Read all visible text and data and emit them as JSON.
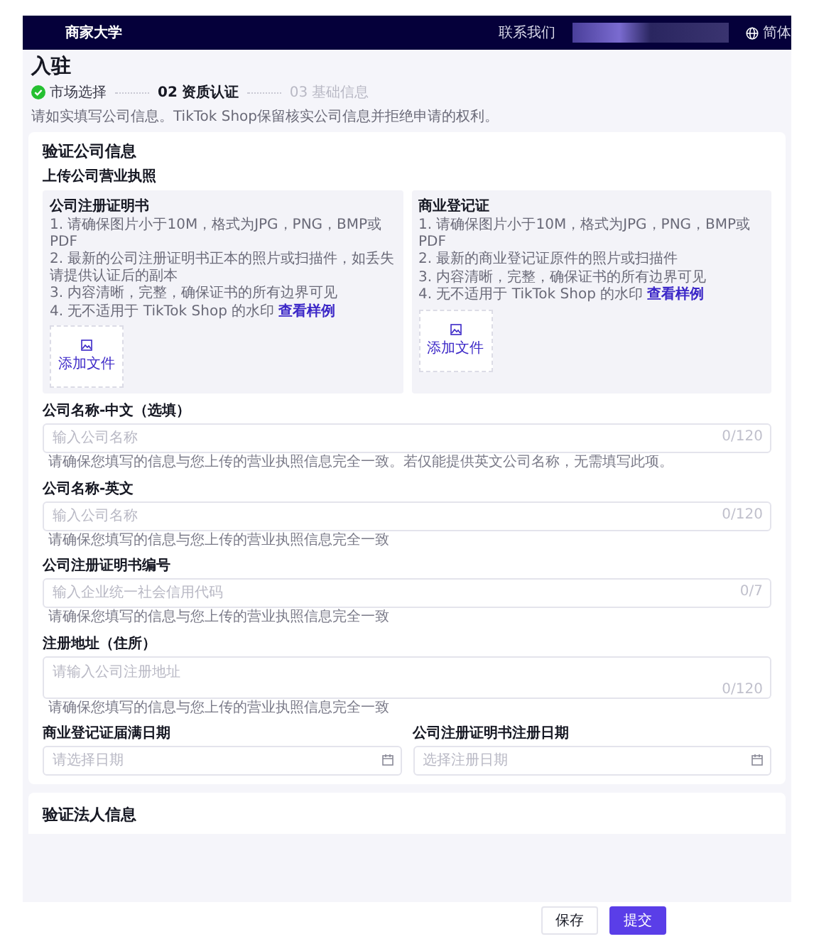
{
  "header": {
    "brand": "商家大学",
    "contact": "联系我们",
    "language": "简体"
  },
  "page": {
    "title": "入驻",
    "steps": [
      {
        "label": "市场选择",
        "done": true,
        "selected": false
      },
      {
        "number": "02",
        "label": "资质认证",
        "done": false,
        "selected": true
      },
      {
        "number": "03",
        "label": "基础信息",
        "done": false,
        "selected": false
      }
    ],
    "notice": "请如实填写公司信息。TikTok Shop保留核实公司信息并拒绝申请的权利。"
  },
  "card": {
    "title": "验证公司信息",
    "upload_title": "上传公司营业执照",
    "panels": [
      {
        "title": "公司注册证明书",
        "items": [
          "1. 请确保图片小于10M，格式为JPG，PNG，BMP或PDF",
          "2. 最新的公司注册证明书正本的照片或扫描件，如丢失请提供认证后的副本",
          "3. 内容清晰，完整，确保证书的所有边界可见",
          "4. 无不适用于 TikTok Shop 的水印"
        ],
        "link": "查看样例",
        "button": "添加文件"
      },
      {
        "title": "商业登记证",
        "items": [
          "1. 请确保图片小于10M，格式为JPG，PNG，BMP或PDF",
          "2. 最新的商业登记证原件的照片或扫描件",
          "3. 内容清晰，完整，确保证书的所有边界可见",
          "4. 无不适用于 TikTok Shop 的水印"
        ],
        "link": "查看样例",
        "button": "添加文件"
      }
    ],
    "fields": [
      {
        "kind": "text",
        "label": "公司名称-中文（选填）",
        "placeholder": "输入公司名称",
        "counter": "0/120",
        "hint": "请确保您填写的信息与您上传的营业执照信息完全一致。若仅能提供英文公司名称，无需填写此项。"
      },
      {
        "kind": "text",
        "label": "公司名称-英文",
        "placeholder": "输入公司名称",
        "counter": "0/120",
        "hint": "请确保您填写的信息与您上传的营业执照信息完全一致"
      },
      {
        "kind": "text",
        "label": "公司注册证明书编号",
        "placeholder": "输入企业统一社会信用代码",
        "counter": "0/7",
        "hint": "请确保您填写的信息与您上传的营业执照信息完全一致"
      },
      {
        "kind": "textarea",
        "label": "注册地址（住所）",
        "placeholder": "请输入公司注册地址",
        "counter": "0/120",
        "hint": "请确保您填写的信息与您上传的营业执照信息完全一致"
      }
    ],
    "date_fields": [
      {
        "label": "商业登记证届满日期",
        "placeholder": "请选择日期"
      },
      {
        "label": "公司注册证明书注册日期",
        "placeholder": "选择注册日期"
      }
    ]
  },
  "next_section": {
    "title": "验证法人信息"
  },
  "footer": {
    "buttons": [
      {
        "label": "保存",
        "kind": "secondary"
      },
      {
        "label": "提交",
        "kind": "primary"
      }
    ]
  }
}
